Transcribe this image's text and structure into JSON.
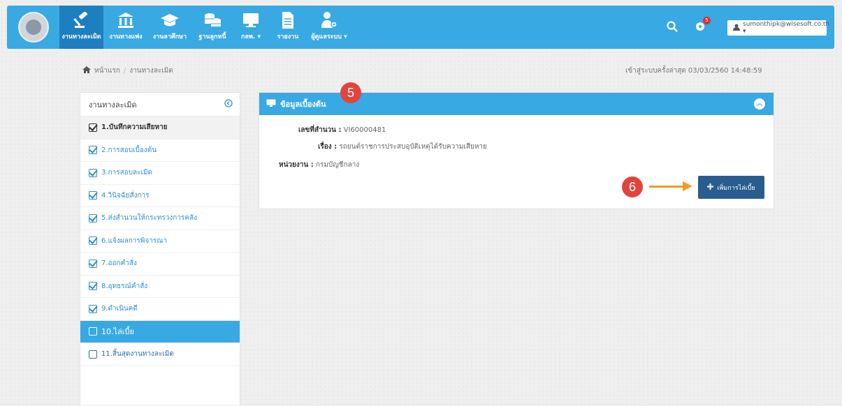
{
  "nav": {
    "items": [
      {
        "label": "งานทางละเมิด",
        "icon": "gavel-icon"
      },
      {
        "label": "งานทางแพ่ง",
        "icon": "bank-icon"
      },
      {
        "label": "งานลาศึกษา",
        "icon": "graduation-cap-icon"
      },
      {
        "label": "ฐานลูกหนี้",
        "icon": "coins-icon"
      },
      {
        "label": "กลพ. ▾",
        "icon": "monitor-icon"
      },
      {
        "label": "รายงาน",
        "icon": "document-icon"
      },
      {
        "label": "ผู้ดูแลระบบ ▾",
        "icon": "user-gear-icon"
      }
    ],
    "notification_count": "5",
    "user_label": "sumonthipk@wisesoft.co.th ▾"
  },
  "breadcrumb": {
    "home": "หน้าแรก",
    "current": "งานทางละเมิด"
  },
  "last_login": "เข้าสู่ระบบครั้งล่าสุด 03/03/2560 14:48:59",
  "sidebar": {
    "title": "งานทางละเมิด",
    "items": [
      {
        "label": "1.บันทึกความเสียหาย",
        "checked": true
      },
      {
        "label": "2.การสอบเบื้องต้น",
        "checked": true
      },
      {
        "label": "3.การสอบละเมิด",
        "checked": true
      },
      {
        "label": "4.วินิจฉัยสั่งการ",
        "checked": true
      },
      {
        "label": "5.ส่งสำนวนให้กระทรวงการคลัง",
        "checked": true
      },
      {
        "label": "6.แจ้งผลการพิจารณา",
        "checked": true
      },
      {
        "label": "7.ออกคำสั่ง",
        "checked": true
      },
      {
        "label": "8.อุทธรณ์คำสั่ง",
        "checked": true
      },
      {
        "label": "9.ดำเนินคดี",
        "checked": true
      },
      {
        "label": "10.ไล่เบี้ย",
        "checked": false
      },
      {
        "label": "11.สิ้นสุดงานทางละเมิด",
        "checked": false
      }
    ]
  },
  "panel": {
    "title": "ข้อมูลเบื้องต้น",
    "fields": {
      "case_no_label": "เลขที่สำนวน :",
      "case_no_value": "VI60000481",
      "subject_label": "เรื่อง :",
      "subject_value": "รถยนต์ราชการประสบอุบัติเหตุได้รับความเสียหาย",
      "agency_label": "หน่วยงาน :",
      "agency_value": "กรมบัญชีกลาง"
    },
    "add_button": "เพิ่มการไล่เบี้ย"
  },
  "annotations": {
    "marker_5": "5",
    "marker_6": "6"
  }
}
